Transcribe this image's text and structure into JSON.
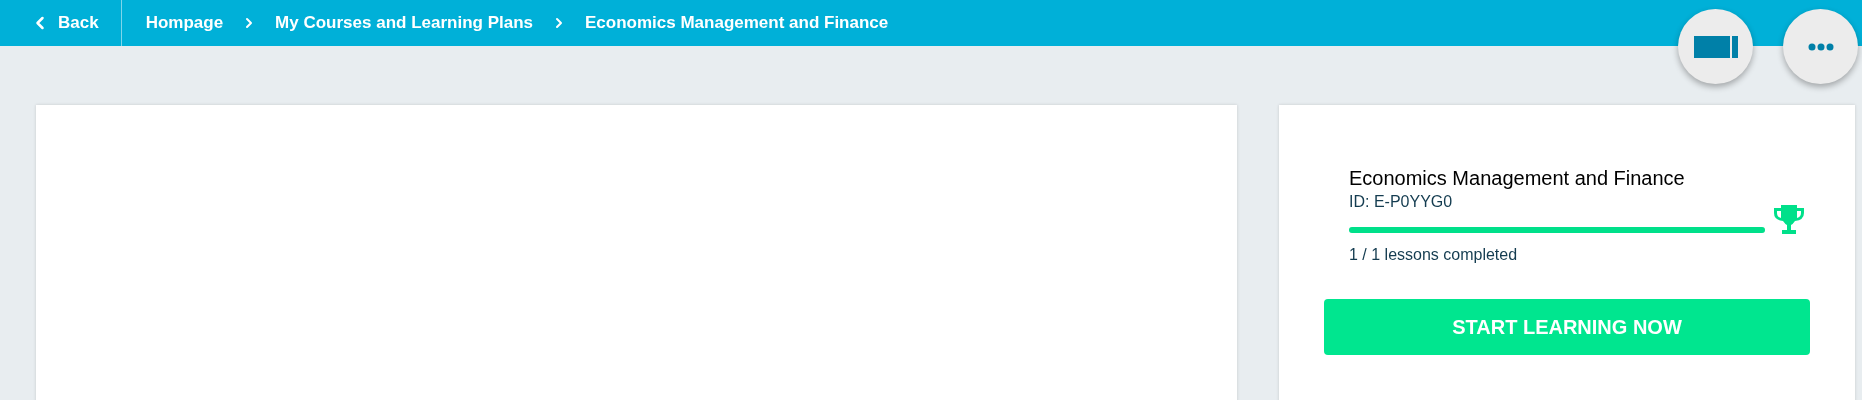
{
  "header": {
    "back": "Back",
    "breadcrumbs": [
      "Hompage",
      "My Courses and Learning Plans",
      "Economics Management and Finance"
    ]
  },
  "course": {
    "title": "Economics Management and Finance",
    "id": "ID: E-P0YYG0",
    "progress": {
      "level": 1
    },
    "lessons": "1 / 1 lessons completed",
    "completed": true,
    "button": "START LEARNING NOW"
  }
}
